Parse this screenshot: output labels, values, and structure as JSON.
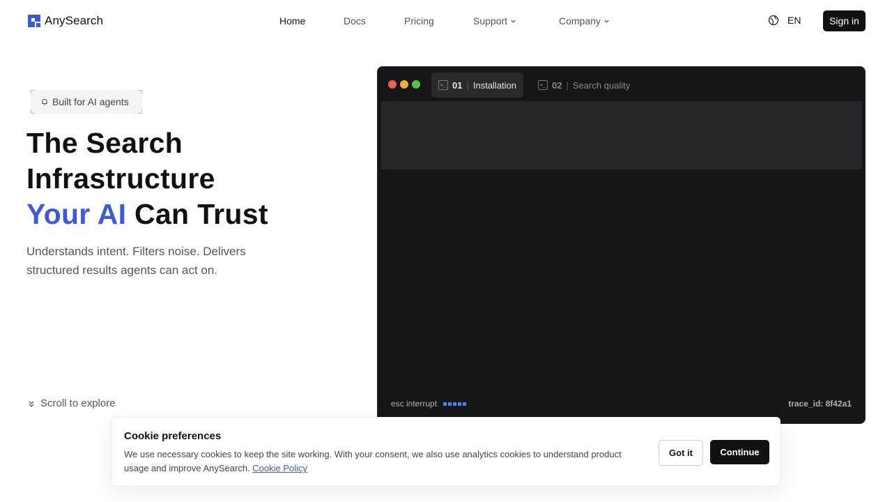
{
  "brand": {
    "name": "AnySearch",
    "accent_color": "#3b5bdb",
    "logo_icon": "anysearch-logo-icon"
  },
  "nav": {
    "items": [
      {
        "label": "Home",
        "active": true
      },
      {
        "label": "Docs",
        "active": false
      },
      {
        "label": "Pricing",
        "active": false
      },
      {
        "label": "Support",
        "active": false,
        "dropdown": true
      },
      {
        "label": "Company",
        "active": false,
        "dropdown": true
      }
    ],
    "language": {
      "label": "EN",
      "icon": "globe-icon"
    },
    "signin_label": "Sign in"
  },
  "hero": {
    "badge": {
      "label": "Built for AI agents",
      "icon": "bell-icon"
    },
    "headline": {
      "line1": "The Search",
      "line2": "Infrastructure",
      "line3_accent": "Your AI",
      "line3_rest": " Can Trust"
    },
    "subtitle": "Understands intent. Filters noise. Delivers structured results agents can act on.",
    "scroll_label": "Scroll to explore"
  },
  "terminal": {
    "window_dots": [
      "#ed5f57",
      "#f0b02f",
      "#4fc34a"
    ],
    "tabs": [
      {
        "num": "01",
        "label": "Installation",
        "active": true,
        "icon": "terminal-icon"
      },
      {
        "num": "02",
        "label": "Search quality",
        "active": false,
        "icon": "terminal-icon"
      }
    ],
    "status_left": "esc interrupt",
    "status_right": "trace_id: 8f42a1",
    "loader_color": "#4c82e8"
  },
  "cookie": {
    "title": "Cookie preferences",
    "text": "We use necessary cookies to keep the site working. With your consent, we also use analytics cookies to understand product usage and improve AnySearch.",
    "link_label": "Cookie Policy",
    "got_it_label": "Got it",
    "continue_label": "Continue"
  }
}
